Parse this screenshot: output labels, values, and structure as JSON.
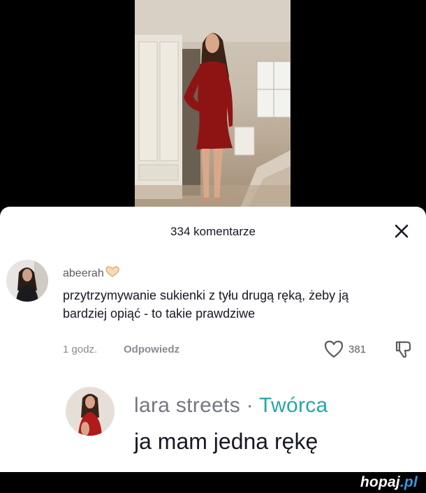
{
  "comments_panel": {
    "title": "334 komentarze"
  },
  "comment": {
    "username": "abeerah",
    "username_emoji": "heart-hands-emoji",
    "text": "przytrzymywanie sukienki z tyłu drugą ręką, żeby ją bardziej opiąć - to takie prawdziwe",
    "time": "1 godz.",
    "reply_label": "Odpowiedz",
    "likes": "381"
  },
  "creator_reply": {
    "username": "lara streets",
    "separator": "·",
    "badge": "Twórca",
    "text": "ja mam jedna rękę"
  },
  "footer": {
    "brand_main": "hopaj",
    "brand_accent": ".pl"
  },
  "colors": {
    "creator_badge": "#26a6a6",
    "brand_accent": "#2f9be0",
    "dress": "#8e1414"
  }
}
